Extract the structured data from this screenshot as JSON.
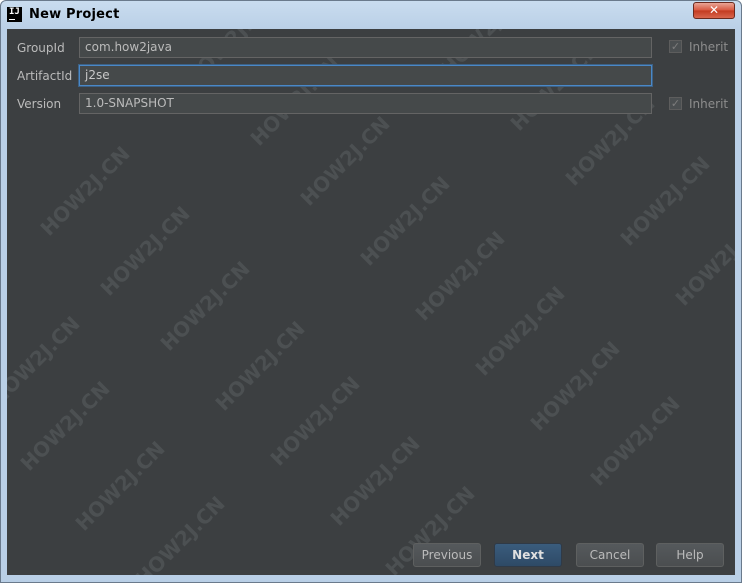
{
  "window": {
    "title": "New Project",
    "close_glyph": "✕",
    "app_icon_text": "IJ"
  },
  "watermark": {
    "text": "HOW2J.CN",
    "color": "#5a5e61"
  },
  "form": {
    "groupid": {
      "label": "GroupId",
      "value": "com.how2java",
      "inherit_label": "Inherit",
      "inherit_checked": true
    },
    "artifactid": {
      "label": "ArtifactId",
      "value": "j2se"
    },
    "version": {
      "label": "Version",
      "value": "1.0-SNAPSHOT",
      "inherit_label": "Inherit",
      "inherit_checked": true
    }
  },
  "buttons": {
    "previous": "Previous",
    "next": "Next",
    "cancel": "Cancel",
    "help": "Help"
  },
  "colors": {
    "background": "#3c3f41",
    "field_background": "#45494a",
    "focus_border": "#4a88c7",
    "default_button": "#365880",
    "text": "#bbbbbb"
  },
  "icons": {
    "app": "intellij-idea-icon",
    "close": "close-icon",
    "checkmark": "checkmark-icon"
  }
}
